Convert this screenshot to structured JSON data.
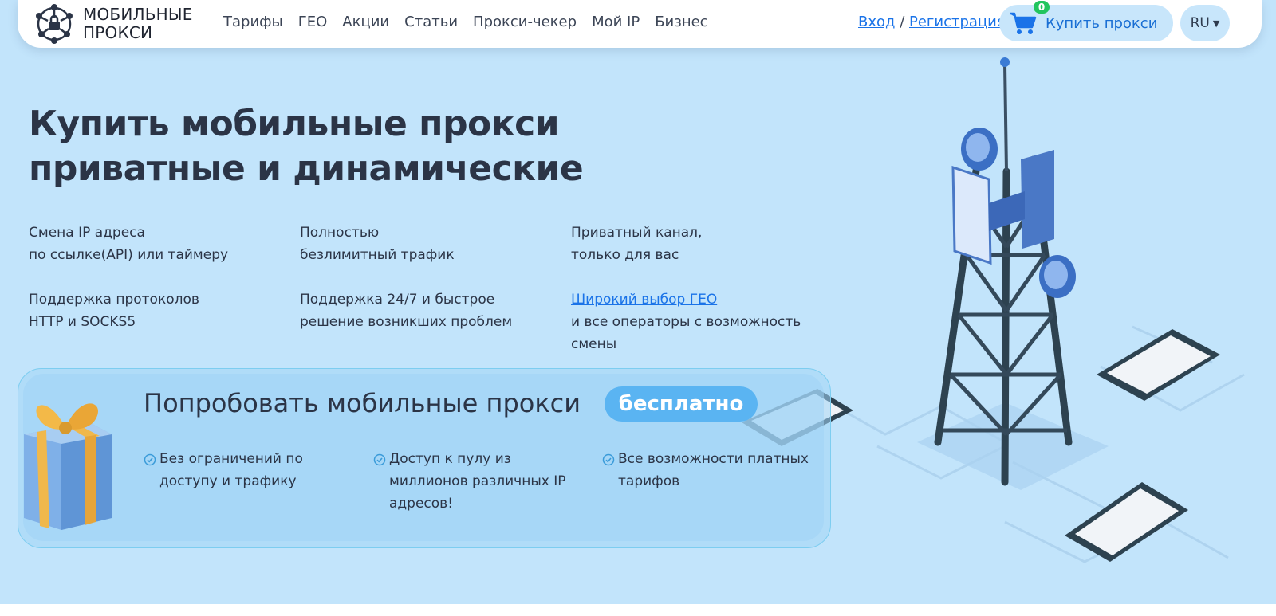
{
  "brand": {
    "line1": "МОБИЛЬНЫЕ",
    "line2": "ПРОКСИ"
  },
  "nav": [
    "Тарифы",
    "ГЕО",
    "Акции",
    "Статьи",
    "Прокси-чекер",
    "Мой IP",
    "Бизнес"
  ],
  "auth": {
    "login": "Вход",
    "separator": " / ",
    "register": "Регистрация"
  },
  "cart": {
    "label": "Купить прокси",
    "count": "0"
  },
  "lang": {
    "current": "RU"
  },
  "hero": {
    "title_line1": "Купить мобильные прокси",
    "title_line2": "приватные и динамические"
  },
  "features": [
    {
      "line1": "Смена IP адреса",
      "line2": "по ссылке(API) или таймеру"
    },
    {
      "line1": "Полностью",
      "line2": "безлимитный трафик"
    },
    {
      "line1": "Приватный канал,",
      "line2": "только для вас"
    },
    {
      "line1": "Поддержка протоколов",
      "line2": "HTTP и SOCKS5"
    },
    {
      "line1": "Поддержка 24/7 и быстрое",
      "line2": "решение возникших проблем"
    },
    {
      "link": "Широкий выбор ГЕО",
      "line2": "и все операторы с возможность",
      "line3": "смены"
    }
  ],
  "promo": {
    "title": "Попробовать мобильные прокси",
    "pill": "бесплатно",
    "benefits": [
      {
        "line1": "Без ограничений по",
        "line2": "доступу и трафику"
      },
      {
        "line1": "Доступ к пулу из",
        "line2": "миллионов различных IP",
        "line3": "адресов!"
      },
      {
        "line1": "Все возможности платных",
        "line2": "тарифов"
      }
    ]
  },
  "colors": {
    "hero_bg": "#c2e4fb",
    "accent": "#1a73e8",
    "pill": "#5ab4f2",
    "badge": "#22c55e",
    "text": "#2b3446"
  }
}
